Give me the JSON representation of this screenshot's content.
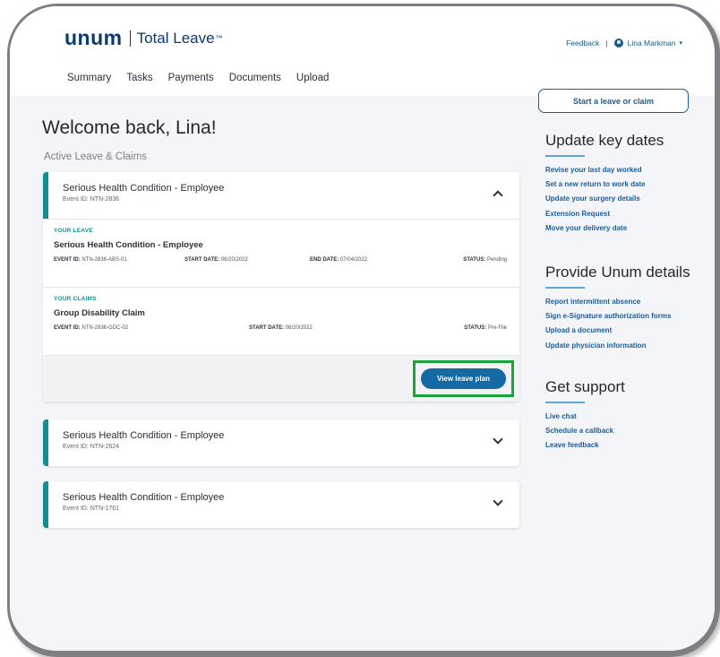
{
  "header": {
    "logo_mark": "unum",
    "product": "Total Leave",
    "tm": "™",
    "feedback": "Feedback",
    "separator": "|",
    "user_name": "Lina Markman",
    "caret": "▾",
    "nav": [
      "Summary",
      "Tasks",
      "Payments",
      "Documents",
      "Upload"
    ]
  },
  "start_button": "Start a leave or claim",
  "welcome": "Welcome back, Lina!",
  "section_label": "Active Leave & Claims",
  "cards": [
    {
      "title": "Serious Health Condition - Employee",
      "event": "Event ID: NTN-2836",
      "expanded": true,
      "leave": {
        "kicker": "YOUR LEAVE",
        "title": "Serious Health Condition - Employee",
        "event_label": "EVENT ID:",
        "event_value": "NTN-2836-ABS-01",
        "start_label": "START DATE:",
        "start_value": "06/20/2022",
        "end_label": "END DATE:",
        "end_value": "07/04/2022",
        "status_label": "STATUS:",
        "status_value": "Pending"
      },
      "claims": {
        "kicker": "YOUR CLAIMS",
        "title": "Group Disability Claim",
        "event_label": "EVENT ID:",
        "event_value": "NTN-2836-GDC-02",
        "start_label": "START DATE:",
        "start_value": "06/20/2022",
        "status_label": "STATUS:",
        "status_value": "Pre-File"
      },
      "action": "View leave plan"
    },
    {
      "title": "Serious Health Condition - Employee",
      "event": "Event ID: NTN-2624",
      "expanded": false
    },
    {
      "title": "Serious Health Condition - Employee",
      "event": "Event ID: NTN-1761",
      "expanded": false
    }
  ],
  "rail": {
    "update_title": "Update key dates",
    "update_links": [
      "Revise your last day worked",
      "Set a new return to work date",
      "Update your surgery details",
      "Extension Request",
      "Move your delivery date"
    ],
    "details_title": "Provide Unum details",
    "details_links": [
      "Report intermittent absence",
      "Sign e-Signature authorization forms",
      "Upload a document",
      "Update physician information"
    ],
    "support_title": "Get support",
    "support_links": [
      "Live chat",
      "Schedule a callback",
      "Leave feedback"
    ]
  },
  "colors": {
    "accent_teal": "#128e8e",
    "brand_navy": "#0a3a6e",
    "link_blue": "#1a5c9a",
    "button_blue": "#1569a5",
    "highlight_green": "#1aa33b"
  }
}
